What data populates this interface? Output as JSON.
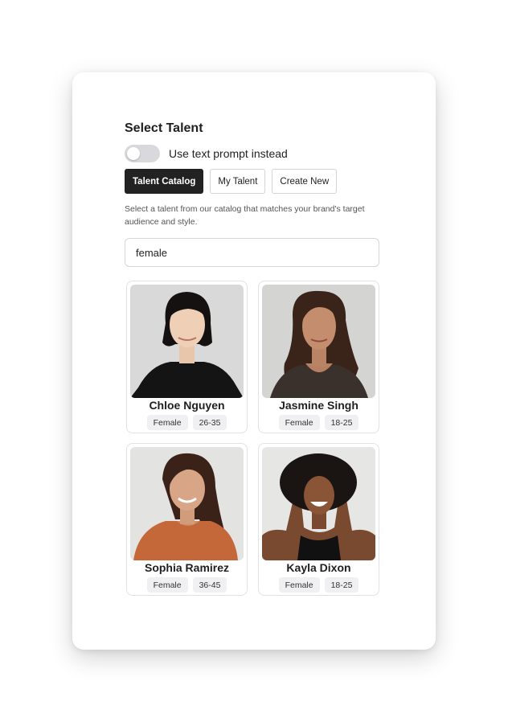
{
  "modal": {
    "title": "Select Talent",
    "toggle": {
      "label": "Use text prompt instead",
      "on": false
    },
    "tabs": [
      {
        "label": "Talent Catalog",
        "active": true
      },
      {
        "label": "My Talent",
        "active": false
      },
      {
        "label": "Create New",
        "active": false
      }
    ],
    "description": "Select a talent from our catalog that matches your brand's target audience and style.",
    "search": {
      "value": "female",
      "placeholder": ""
    },
    "talents": [
      {
        "name": "Chloe Nguyen",
        "gender": "Female",
        "age": "26-35"
      },
      {
        "name": "Jasmine Singh",
        "gender": "Female",
        "age": "18-25"
      },
      {
        "name": "Sophia Ramirez",
        "gender": "Female",
        "age": "36-45"
      },
      {
        "name": "Kayla Dixon",
        "gender": "Female",
        "age": "18-25"
      }
    ]
  },
  "colors": {
    "accent": "#222222",
    "toggle_off": "#d8d8dd",
    "badge_bg": "#f0f0f2"
  }
}
